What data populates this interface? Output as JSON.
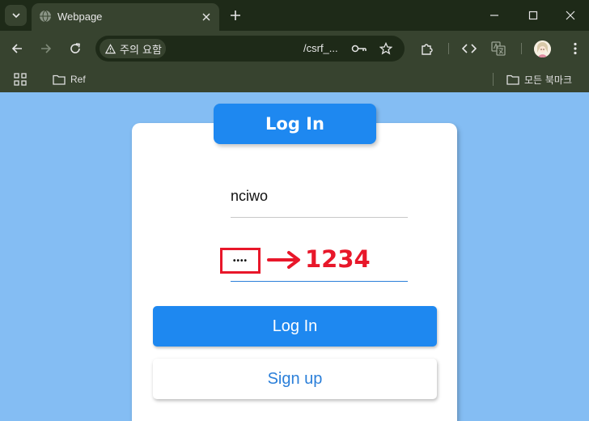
{
  "browser": {
    "tab_title": "Webpage",
    "security_chip": "주의 요함",
    "url": "/csrf_...",
    "bookmarks": {
      "left_folder": "Ref",
      "all_bookmarks": "모든 북마크"
    }
  },
  "page": {
    "header_title": "Log In",
    "username_value": "nciwo",
    "password_value": "••••",
    "annotation_text": "1234",
    "login_button": "Log In",
    "signup_button": "Sign up"
  },
  "colors": {
    "page_bg": "#84bdf3",
    "accent_blue": "#1e88f0",
    "annotation_red": "#e8172a"
  }
}
